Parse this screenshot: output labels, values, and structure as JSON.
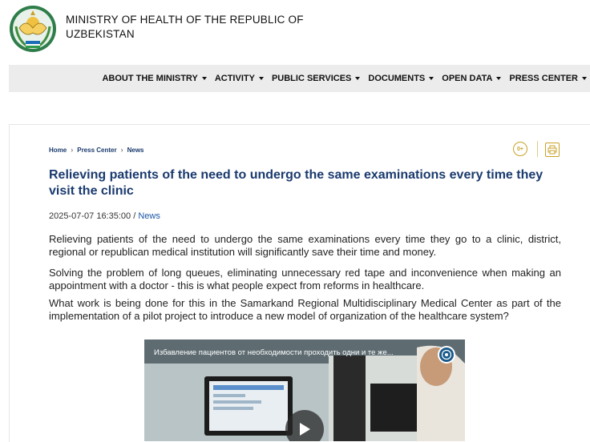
{
  "header": {
    "ministry_name_line1": "MINISTRY OF HEALTH OF THE REPUBLIC OF",
    "ministry_name_line2": "UZBEKISTAN"
  },
  "nav": {
    "items": [
      {
        "label": "ABOUT THE MINISTRY"
      },
      {
        "label": "ACTIVITY"
      },
      {
        "label": "PUBLIC SERVICES"
      },
      {
        "label": "DOCUMENTS"
      },
      {
        "label": "OPEN DATA"
      },
      {
        "label": "PRESS CENTER"
      }
    ]
  },
  "breadcrumb": {
    "home": "Home",
    "press_center": "Press Center",
    "news": "News",
    "separator": "›"
  },
  "tools": {
    "age_rating": "0+"
  },
  "article": {
    "title": "Relieving patients of the need to undergo the same examinations every time they visit the clinic",
    "date": "2025-07-07 16:35:00",
    "date_separator": " / ",
    "category": "News",
    "paragraphs": [
      "Relieving patients of the need to undergo the same examinations every time they go to a clinic, district, regional or republican medical institution will significantly save their time and money.",
      "Solving the problem of long queues, eliminating unnecessary red tape and inconvenience when making an appointment with a doctor - this is what people expect from reforms in healthcare.",
      "What work is being done for this in the Samarkand Regional Multidisciplinary Medical Center as part of the implementation of a pilot project to introduce a new model of organization of the healthcare system?"
    ]
  },
  "video": {
    "title": "Избавление пациентов от необходимости проходить одни и те же..."
  },
  "colors": {
    "accent_blue": "#1a3a6e",
    "link_blue": "#1a56a6",
    "gold": "#c9a227",
    "nav_bg": "#ececec"
  }
}
